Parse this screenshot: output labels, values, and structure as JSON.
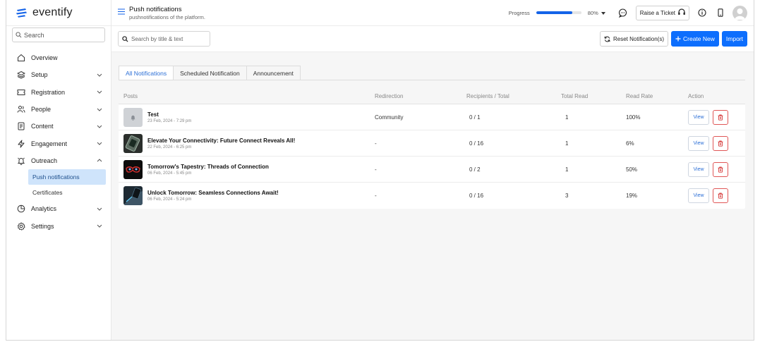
{
  "brand": {
    "name": "eventify",
    "color": "#1463e8"
  },
  "sidebar": {
    "search_placeholder": "Search",
    "items": [
      {
        "label": "Overview",
        "icon": "home-icon",
        "chevron": false
      },
      {
        "label": "Setup",
        "icon": "layers-icon",
        "chevron": "down"
      },
      {
        "label": "Registration",
        "icon": "ticket-icon",
        "chevron": "down"
      },
      {
        "label": "People",
        "icon": "people-icon",
        "chevron": "down"
      },
      {
        "label": "Content",
        "icon": "document-icon",
        "chevron": "down"
      },
      {
        "label": "Engagement",
        "icon": "lightning-icon",
        "chevron": "down"
      },
      {
        "label": "Outreach",
        "icon": "bell-icon",
        "chevron": "up"
      }
    ],
    "outreach_sub": [
      {
        "label": "Push notifications",
        "active": true
      },
      {
        "label": "Certificates",
        "active": false
      }
    ],
    "items_after": [
      {
        "label": "Analytics",
        "icon": "pie-chart-icon",
        "chevron": "down"
      },
      {
        "label": "Settings",
        "icon": "gear-icon",
        "chevron": "down"
      }
    ]
  },
  "header": {
    "title": "Push notifications",
    "subtitle": "pushnotifications of the platform.",
    "progress_label": "Progress",
    "progress_value": 80,
    "progress_text": "80%",
    "raise_ticket_label": "Raise a Ticket"
  },
  "toolbar": {
    "search_placeholder": "Search by title & text",
    "reset_label": "Reset Notification(s)",
    "create_label": "Create New",
    "import_label": "Import"
  },
  "tabs": [
    {
      "label": "All Notifications",
      "active": true
    },
    {
      "label": "Scheduled Notification",
      "active": false
    },
    {
      "label": "Announcement",
      "active": false
    }
  ],
  "table": {
    "columns": [
      "Posts",
      "Redirection",
      "Recipients / Total",
      "Total Read",
      "Read Rate",
      "Action"
    ],
    "view_label": "View",
    "rows": [
      {
        "title": "Test",
        "date": "23 Feb, 2024 - 7:29 pm",
        "redirection": "Community",
        "recipients": "0 / 1",
        "total_read": "1",
        "read_rate": "100%",
        "thumb": "bell"
      },
      {
        "title": "Elevate Your Connectivity: Future Connect Reveals All!",
        "date": "22 Feb, 2024 - 6:25 pm",
        "redirection": "-",
        "recipients": "0 / 16",
        "total_read": "1",
        "read_rate": "6%",
        "thumb": "device"
      },
      {
        "title": "Tomorrow's Tapestry: Threads of Connection",
        "date": "06 Feb, 2024 - 5:45 pm",
        "redirection": "-",
        "recipients": "0 / 2",
        "total_read": "1",
        "read_rate": "50%",
        "thumb": "glasses"
      },
      {
        "title": "Unlock Tomorrow: Seamless Connections Await!",
        "date": "06 Feb, 2024 - 5:24 pm",
        "redirection": "-",
        "recipients": "0 / 16",
        "total_read": "3",
        "read_rate": "19%",
        "thumb": "hand"
      }
    ]
  }
}
